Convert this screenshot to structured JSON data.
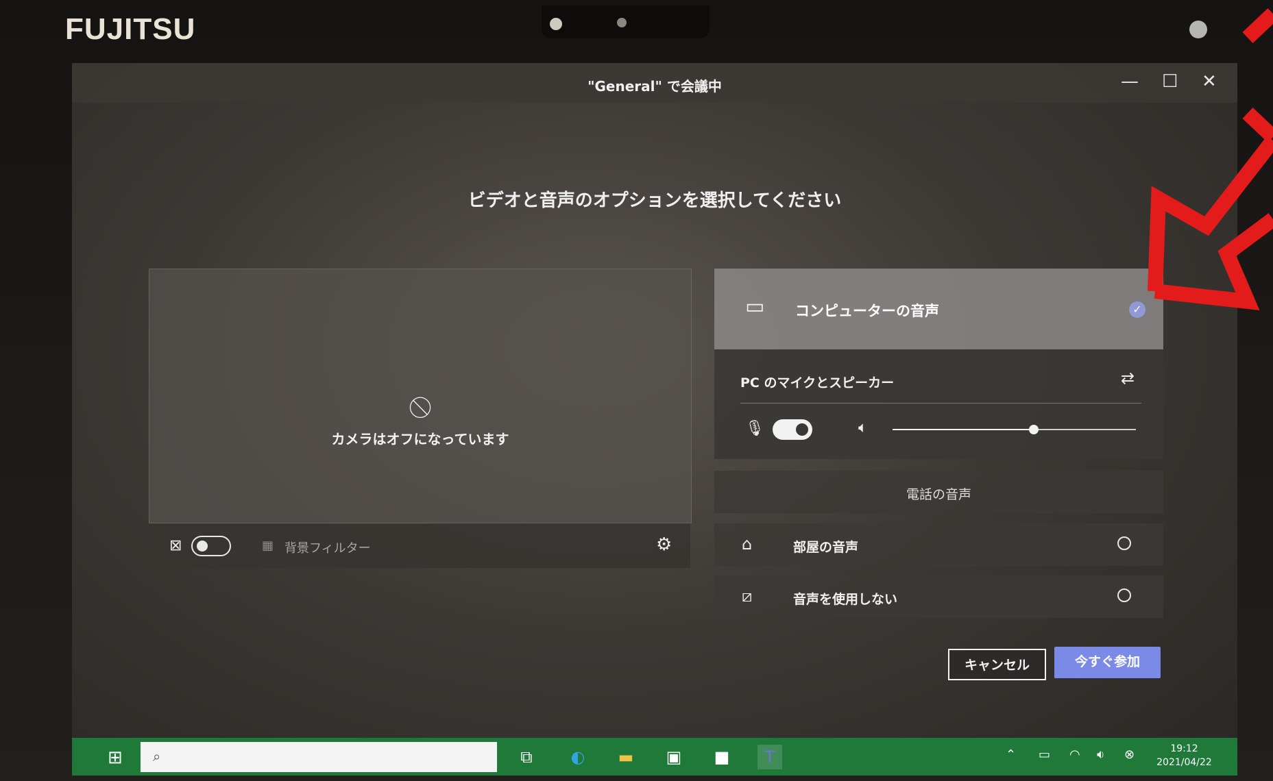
{
  "device": {
    "brand": "FUJITSU"
  },
  "window": {
    "title": "\"General\" で会議中",
    "min_glyph": "—",
    "max_glyph": "☐",
    "close_glyph": "✕"
  },
  "heading": "ビデオと音声のオプションを選択してください",
  "video": {
    "camera_off_text": "カメラはオフになっています",
    "camera_toggle_on": false,
    "background_filter_label": "背景フィルター"
  },
  "audio": {
    "computer_audio": {
      "label": "コンピューターの音声",
      "selected": true
    },
    "pc_devices": {
      "label": "PC のマイクとスピーカー",
      "mic_on": true,
      "volume": 0.58
    },
    "phone_audio": {
      "label": "電話の音声"
    },
    "room_audio": {
      "label": "部屋の音声",
      "selected": false
    },
    "no_audio": {
      "label": "音声を使用しない",
      "selected": false
    }
  },
  "buttons": {
    "cancel": "キャンセル",
    "join": "今すぐ参加"
  },
  "taskbar": {
    "time": "19:12",
    "date": "2021/04/22"
  },
  "colors": {
    "accent": "#7b8ae6",
    "taskbar": "#1f7a3a",
    "annotation": "#e31b1b"
  },
  "icons": [
    "camera-off-icon",
    "gear-icon",
    "computer-audio-icon",
    "check-icon",
    "device-settings-icon",
    "mic-icon",
    "speaker-icon",
    "room-icon",
    "no-audio-icon",
    "windows-start-icon",
    "search-icon",
    "edge-icon",
    "explorer-icon",
    "teams-icon"
  ]
}
